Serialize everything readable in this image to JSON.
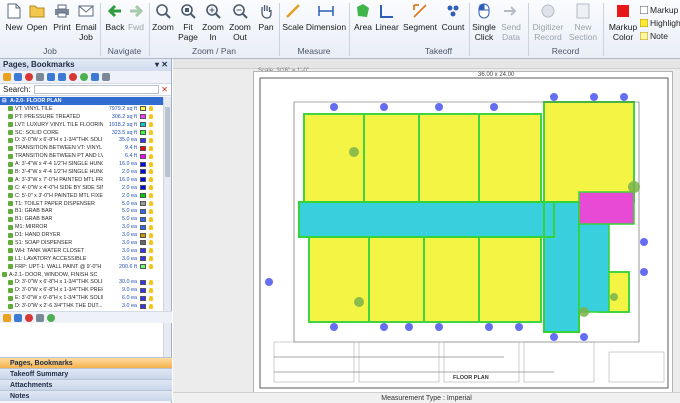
{
  "ribbon": {
    "buttons": [
      {
        "label": "New",
        "icon": "new-document-icon"
      },
      {
        "label": "Open",
        "icon": "open-folder-icon"
      },
      {
        "label": "Print",
        "icon": "printer-icon"
      },
      {
        "label": "Email\nJob",
        "icon": "email-icon"
      },
      {
        "label": "Back",
        "icon": "arrow-left-icon"
      },
      {
        "label": "Fwd",
        "icon": "arrow-right-icon"
      },
      {
        "label": "Zoom",
        "icon": "zoom-icon"
      },
      {
        "label": "Fit\nPage",
        "icon": "fit-page-icon"
      },
      {
        "label": "Zoom\nIn",
        "icon": "zoom-in-icon"
      },
      {
        "label": "Zoom\nOut",
        "icon": "zoom-out-icon"
      },
      {
        "label": "Pan",
        "icon": "pan-hand-icon"
      },
      {
        "label": "Scale",
        "icon": "scale-icon"
      },
      {
        "label": "Dimension",
        "icon": "dimension-icon"
      },
      {
        "label": "Area",
        "icon": "area-icon"
      },
      {
        "label": "Linear",
        "icon": "linear-icon"
      },
      {
        "label": "Segment",
        "icon": "segment-icon"
      },
      {
        "label": "Count",
        "icon": "count-icon"
      },
      {
        "label": "Single\nClick",
        "icon": "single-click-icon"
      },
      {
        "label": "Send\nData",
        "icon": "send-data-icon"
      },
      {
        "label": "Digitizer\nRecord",
        "icon": "digitizer-record-icon"
      },
      {
        "label": "New\nSection",
        "icon": "new-section-icon"
      },
      {
        "label": "Markup\nColor",
        "icon": "markup-color-icon"
      }
    ],
    "groups": [
      "Job",
      "Navigate",
      "Zoom / Pan",
      "Measure",
      "Takeoff",
      "Record"
    ],
    "small_buttons": [
      "Markup",
      "Highlight",
      "Note"
    ]
  },
  "left_panel": {
    "title": "Pages, Bookmarks",
    "search_label": "Search:",
    "tree_header": "A-2.0- FLOOR PLAN",
    "tree_items": [
      {
        "name": "VT: VINYL TILE",
        "qty": "7979.2 sq ft",
        "color": "#ffff33"
      },
      {
        "name": "PT: PRESSURE TREATED",
        "qty": "306.2 sq ft",
        "color": "#ff33ff"
      },
      {
        "name": "LVT: LUXURY VINYL TILE FLOORING",
        "qty": "1918.2 sq ft",
        "color": "#00cccc"
      },
      {
        "name": "SC: SOLID CORE",
        "qty": "323.5 sq ft",
        "color": "#33ff33"
      },
      {
        "name": "D: 3'-0\"W x 6'-8\"H x 1-3/4\"THK SOLID CORE W...",
        "qty": "35.0 ea",
        "color": "#3333ff"
      },
      {
        "name": "TRANSITION BETWEEN VT: VINYL TILE AND...",
        "qty": "9.4 ft",
        "color": "#ff0000"
      },
      {
        "name": "TRANSITION BETWEEN PT AND LVT",
        "qty": "6.4 ft",
        "color": "#ff00ff"
      },
      {
        "name": "A: 3'-4\"W x 4'-4 1/2\"H SINGLE HUNG DE...",
        "qty": "16.0 ea",
        "color": "#0000ff"
      },
      {
        "name": "B: 3'-4\"W x 4'-4 1/2\"H SINGLE HUNG DE...",
        "qty": "2.0 ea",
        "color": "#0000ff"
      },
      {
        "name": "A: 3'-3\"W x 7'-0\"H PAINTED MTL FRAME...",
        "qty": "16.0 ea",
        "color": "#0000ff"
      },
      {
        "name": "C: 4'-0\"W x 4'-0\"H SIDE BY SIDE SINGLE...",
        "qty": "2.0 ea",
        "color": "#0000ff"
      },
      {
        "name": "C: 5'-0\" x 3'-0\"H PAINTED MTL FIXED GLA...",
        "qty": "2.0 ea",
        "color": "#00cc00"
      },
      {
        "name": "T1: TOILET PAPER DISPENSER",
        "qty": "5.0 ea",
        "color": "#999999"
      },
      {
        "name": "B1: GRAB BAR",
        "qty": "5.0 ea",
        "color": "#3366ff"
      },
      {
        "name": "B1: GRAB BAR",
        "qty": "5.0 ea",
        "color": "#3366ff"
      },
      {
        "name": "M1: MIRROR",
        "qty": "3.0 ea",
        "color": "#3366ff"
      },
      {
        "name": "D1: HAND DRYER",
        "qty": "3.0 ea",
        "color": "#cc9900"
      },
      {
        "name": "S1: SOAP DISPENSER",
        "qty": "3.0 ea",
        "color": "#666666"
      },
      {
        "name": "WH: TANK WATER CLOSET",
        "qty": "3.0 ea",
        "color": "#3333ff"
      },
      {
        "name": "L1: LAVATORY ACCESSIBLE",
        "qty": "3.0 ea",
        "color": "#3333ff"
      },
      {
        "name": "FRP: UPT-1: WALL PAINT @ 9'-0\"H",
        "qty": "200.6 ft",
        "color": "#66ff66"
      },
      {
        "name": "A-2.1- DOOR, WINDOW, FINISH SCHEDULE",
        "qty": "",
        "color": ""
      },
      {
        "name": "D: 3'-0\"W x 6'-8\"H x 1-3/4\"THK SOLID...",
        "qty": "30.0 ea",
        "color": "#3333ff"
      },
      {
        "name": "D: 3'-0\"W x 6'-8\"H x 1-3/4\"THK PREHU...",
        "qty": "9.0 ea",
        "color": "#3333ff"
      },
      {
        "name": "E: 3'-0\"W x 6'-8\"H x 1-3/4\"THK SOLID...",
        "qty": "6.0 ea",
        "color": "#3333ff"
      },
      {
        "name": "D: 3'-0\"W x 2'-6 3/4\"THK THE DUT...",
        "qty": "3.0 ea",
        "color": "#3333ff"
      },
      {
        "name": "D: 3'-0\"W x 6'-8\"H x 1-3/4\"THK DOOR W...",
        "qty": "3.0 ea",
        "color": "#3333ff"
      }
    ],
    "panel_tabs": [
      "Pages, Bookmarks",
      "Takeoff Summary",
      "Attachments",
      "Notes"
    ]
  },
  "canvas": {
    "scale_label": "Scale: 3/16\" = 1'-0\"",
    "size_label": "36.00 x 24.00",
    "floor_label": "FLOOR PLAN",
    "status": "Measurement Type : Imperial"
  },
  "colors": {
    "area_yellow": "#f4f43b",
    "area_cyan": "#38d0dc",
    "area_magenta": "#e84ad6",
    "outline_green": "#36d336",
    "count_blue": "#4a55f0"
  }
}
